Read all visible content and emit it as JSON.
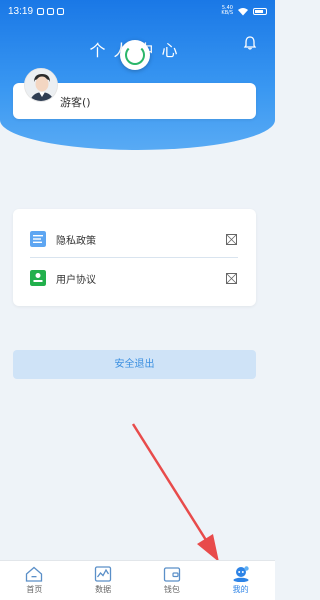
{
  "status_bar": {
    "time": "13:19",
    "network_top": "5.40",
    "network_bottom": "KB/S"
  },
  "header": {
    "title": "个人中心"
  },
  "user": {
    "name": "游客()"
  },
  "menu": {
    "items": [
      {
        "label": "隐私政策",
        "icon": "document-icon"
      },
      {
        "label": "用户协议",
        "icon": "user-agreement-icon"
      }
    ]
  },
  "logout": {
    "label": "安全退出"
  },
  "nav": {
    "items": [
      {
        "label": "首页",
        "icon": "home-icon"
      },
      {
        "label": "数据",
        "icon": "chart-icon"
      },
      {
        "label": "钱包",
        "icon": "wallet-icon"
      },
      {
        "label": "我的",
        "icon": "profile-icon"
      }
    ]
  },
  "colors": {
    "primary": "#1a78e6",
    "accent": "#3b8fe0",
    "arrow": "#e84b4b"
  }
}
